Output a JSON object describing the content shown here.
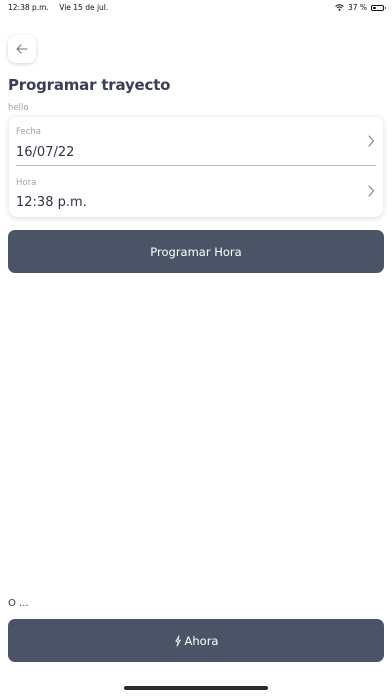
{
  "status_bar": {
    "time": "12:38 p.m.",
    "date": "Vie 15 de jul.",
    "battery_percent": "37 %",
    "battery_level": 0.37,
    "icons": [
      "wifi-icon",
      "battery-icon"
    ]
  },
  "header": {
    "back_icon": "arrow-left-icon",
    "title": "Programar trayecto",
    "subtitle": "hello"
  },
  "form": {
    "date": {
      "label": "Fecha",
      "value": "16/07/22",
      "icon": "chevron-right-icon"
    },
    "time": {
      "label": "Hora",
      "value": "12:38 p.m.",
      "icon": "chevron-right-icon"
    }
  },
  "actions": {
    "schedule_label": "Programar Hora",
    "or_text": "O ...",
    "now_label": "Ahora",
    "now_icon": "lightning-icon"
  },
  "colors": {
    "button": "#4b5467",
    "title": "#3a4052",
    "muted": "#9ea2ab"
  }
}
